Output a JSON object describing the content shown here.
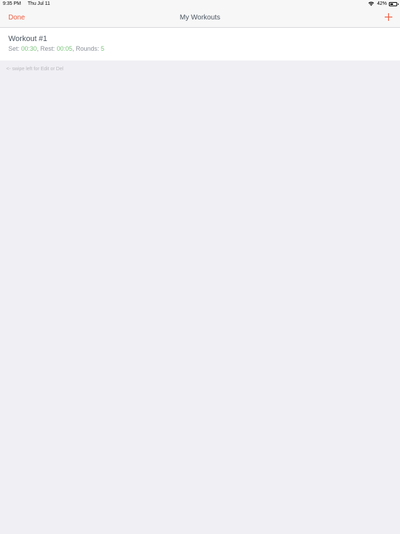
{
  "status_bar": {
    "time": "9:35 PM",
    "date": "Thu Jul 11",
    "battery": "42%",
    "icons": [
      "wifi-icon",
      "battery-icon"
    ]
  },
  "nav": {
    "done_label": "Done",
    "title": "My Workouts",
    "add_icon": "plus-icon"
  },
  "workouts": [
    {
      "name": "Workout #1",
      "set_label": "Set: ",
      "set_value": "00:30",
      "rest_label": ", Rest: ",
      "rest_value": "00:05",
      "rounds_label": ", Rounds: ",
      "rounds_value": "5"
    }
  ],
  "hint": "<- swipe left for Edit or Del",
  "colors": {
    "accent": "#ef5a3c",
    "value_green": "#7bc47a",
    "background": "#efeff4"
  }
}
